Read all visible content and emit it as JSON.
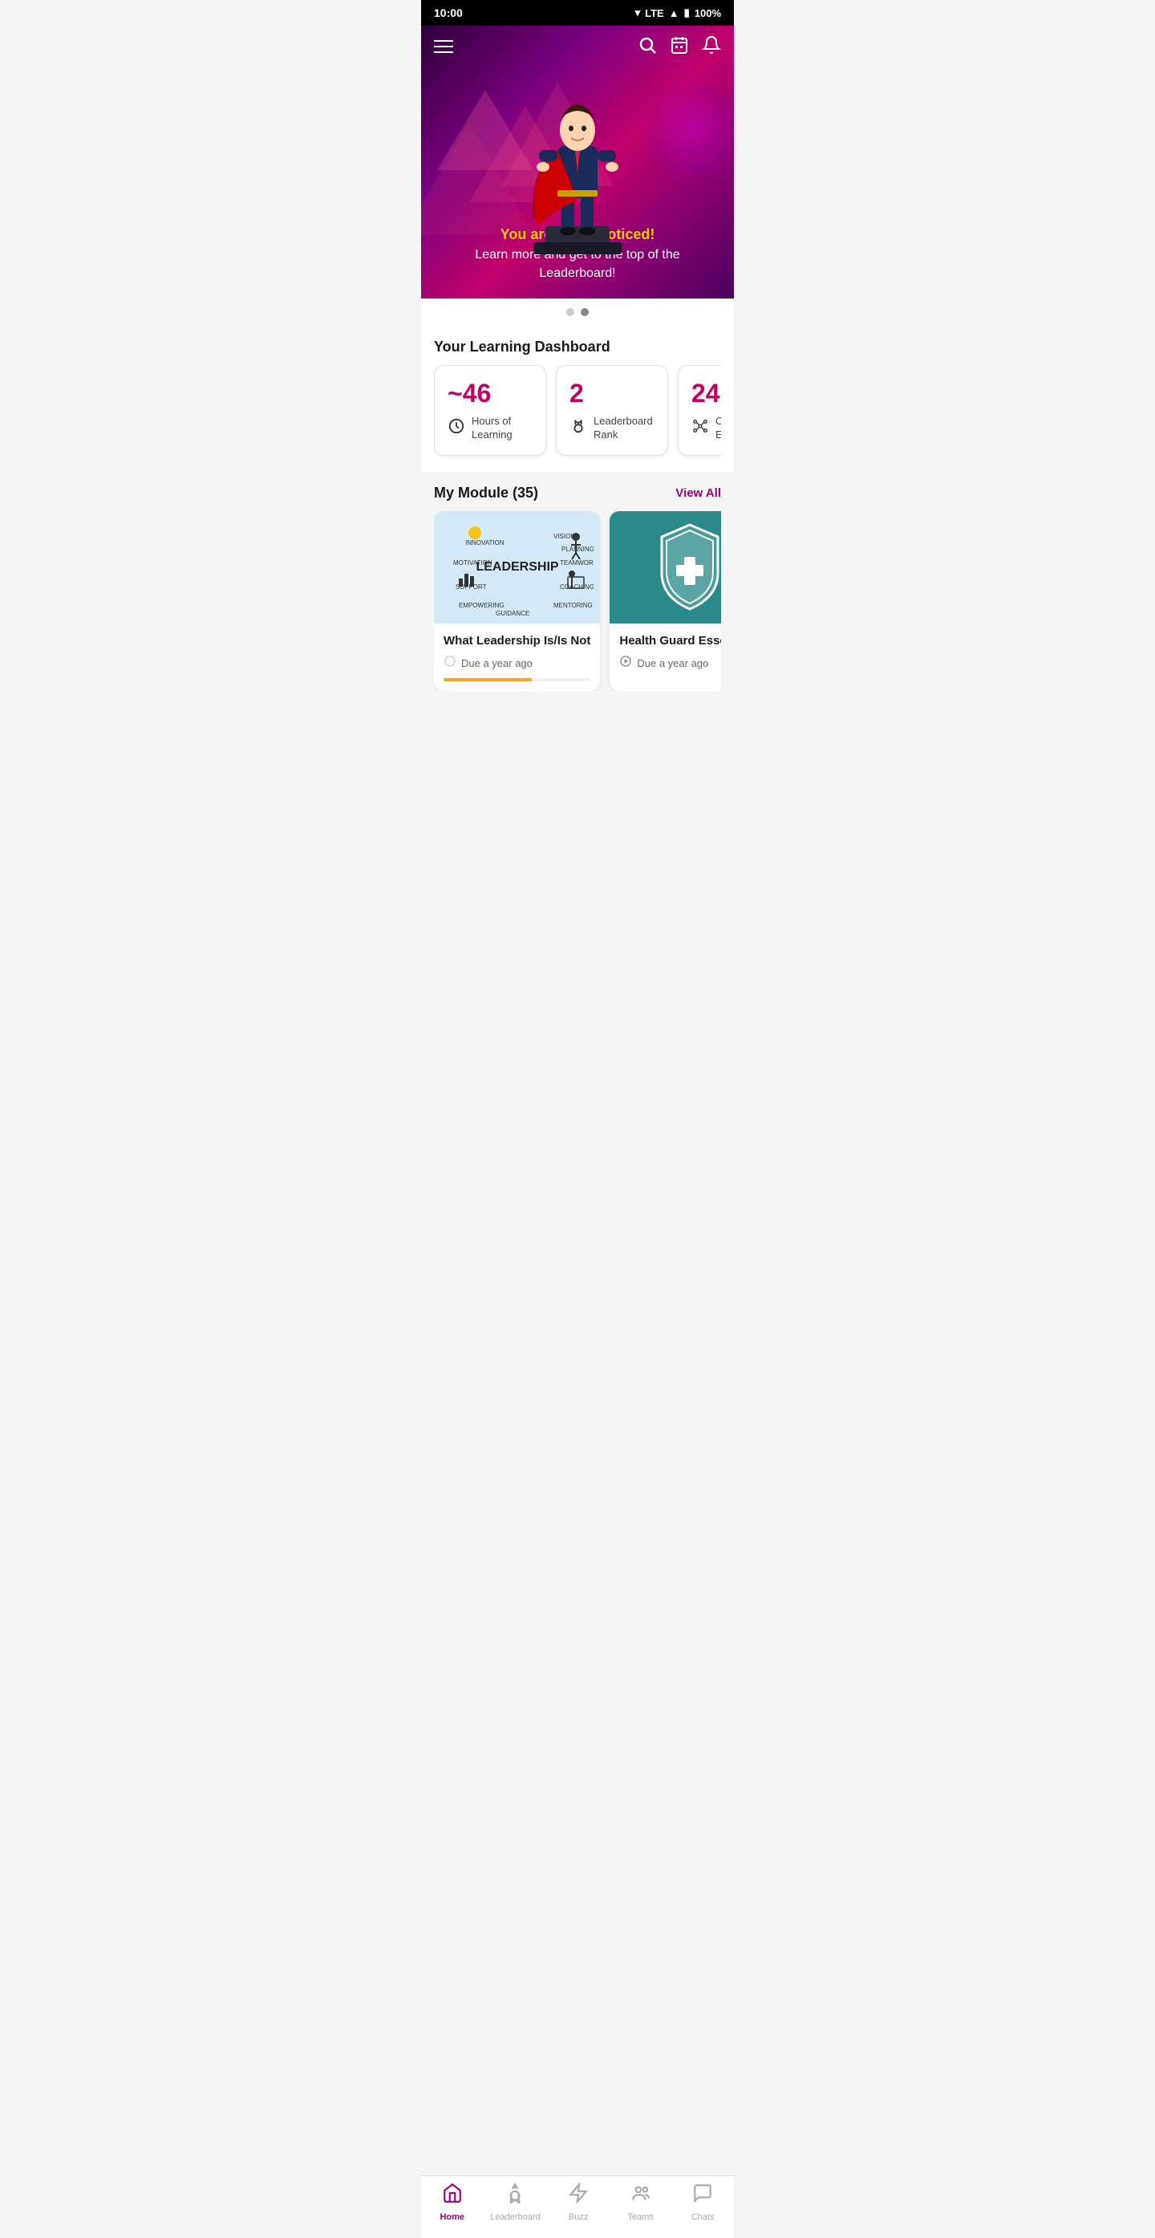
{
  "status_bar": {
    "time": "10:00",
    "signal": "LTE",
    "battery": "100%"
  },
  "hero": {
    "highlight_text": "You are being noticed!",
    "subtitle_text": "Learn more and get to the top of the Leaderboard!",
    "pagination": {
      "dots": [
        false,
        true
      ]
    }
  },
  "dashboard": {
    "title": "Your Learning Dashboard",
    "stats": [
      {
        "value": "~46",
        "label": "Hours of\nLearning",
        "icon": "clock"
      },
      {
        "value": "2",
        "label": "Leaderboard Rank",
        "icon": "medal"
      },
      {
        "value": "24",
        "label": "Courses Enrolled",
        "icon": "network"
      }
    ]
  },
  "modules": {
    "title": "My Module (35)",
    "view_all_label": "View All",
    "items": [
      {
        "id": 1,
        "title": "What Leadership Is/Is Not",
        "due": "Due a year ago",
        "type": "leadership",
        "progress": 60
      },
      {
        "id": 2,
        "title": "Health Guard Essentials",
        "due": "Due a year ago",
        "type": "health",
        "progress": 0
      }
    ]
  },
  "bottom_nav": {
    "items": [
      {
        "id": "home",
        "label": "Home",
        "active": true,
        "icon": "house"
      },
      {
        "id": "leaderboard",
        "label": "Leaderboard",
        "active": false,
        "icon": "medal"
      },
      {
        "id": "buzz",
        "label": "Buzz",
        "active": false,
        "icon": "lightning"
      },
      {
        "id": "teams",
        "label": "Teams",
        "active": false,
        "icon": "people"
      },
      {
        "id": "chats",
        "label": "Chats",
        "active": false,
        "icon": "chat"
      }
    ]
  }
}
